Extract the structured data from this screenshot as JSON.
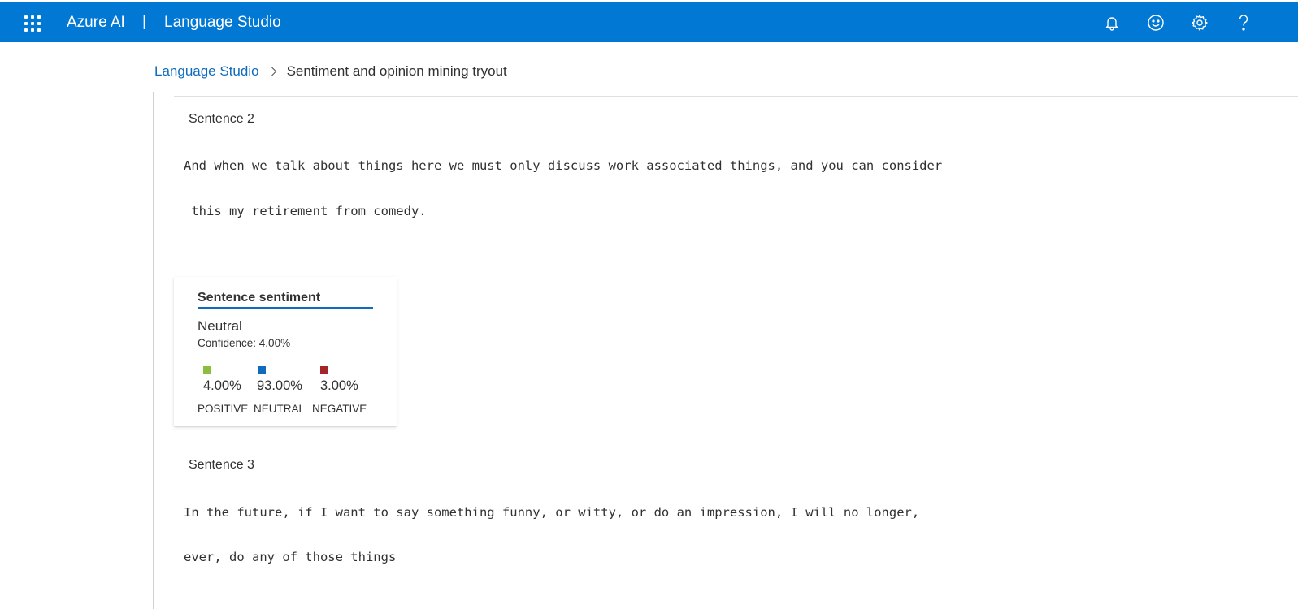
{
  "header": {
    "brand": "Azure AI",
    "separator": "|",
    "product": "Language Studio",
    "icons": [
      "bell-icon",
      "smiley-icon",
      "gear-icon",
      "help-icon"
    ]
  },
  "breadcrumb": {
    "parent": "Language Studio",
    "current": "Sentiment and opinion mining tryout"
  },
  "sentences": [
    {
      "title": "Sentence 2",
      "lines": [
        "And when we talk about things here we must only discuss work associated things, and you can consider",
        " this my retirement from comedy."
      ],
      "card": {
        "title": "Sentence sentiment",
        "label": "Neutral",
        "confidence": "Confidence: 4.00%",
        "metrics": [
          {
            "value": "4.00%",
            "label": "POSITIVE",
            "color": "#8cbd3f"
          },
          {
            "value": "93.00%",
            "label": "NEUTRAL",
            "color": "#0f6cbd"
          },
          {
            "value": "3.00%",
            "label": "NEGATIVE",
            "color": "#a4262c"
          }
        ]
      }
    },
    {
      "title": "Sentence 3",
      "lines": [
        "In the future, if I want to say something funny, or witty, or do an impression, I will no longer,",
        "ever, do any of those things"
      ]
    }
  ],
  "colors": {
    "topbar": "#0078d4",
    "link": "#0f6cbd"
  }
}
